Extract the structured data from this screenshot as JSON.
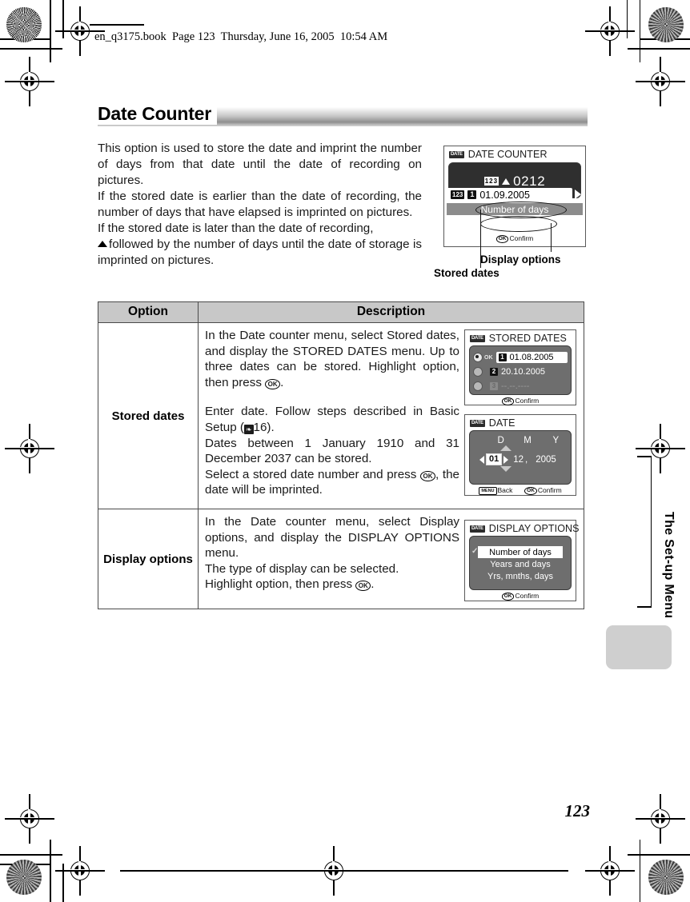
{
  "header": {
    "file_line": "en_q3175.book  Page 123  Thursday, June 16, 2005  10:54 AM"
  },
  "page": {
    "title": "Date Counter",
    "number": "123",
    "side_tab": "The Set-up Menu"
  },
  "intro": {
    "p1": "This option is used to store the date and imprint the number of days from that date until the date of recording on pictures.",
    "p2": "If the stored date is earlier than the date of recording, the number of days that have elapsed is imprinted on pictures.",
    "p3_pre": "",
    "p3": "followed by the number of days until the date of storage is imprinted on pictures.",
    "p3_lead": "If the stored date is later than the date of recording,"
  },
  "callouts": {
    "stored_dates": "Stored dates",
    "display_options": "Display options"
  },
  "lcd_date_counter": {
    "badge": "DATE",
    "title": "DATE COUNTER",
    "counter_segment": "123",
    "counter_value": "0212",
    "row_badge": "123",
    "row_number": "1",
    "row_date": "01.09.2005",
    "row_option": "Number of days",
    "footer_button": "OK",
    "footer_label": "Confirm"
  },
  "lcd_stored_dates": {
    "badge": "DATE",
    "title": "STORED DATES",
    "ok_marker": "OK",
    "rows": [
      {
        "num": "1",
        "date": "01.08.2005",
        "selected": true
      },
      {
        "num": "2",
        "date": "20.10.2005",
        "selected": false
      },
      {
        "num": "3",
        "date": "--.--.----",
        "selected": false
      }
    ],
    "footer_button": "OK",
    "footer_label": "Confirm"
  },
  "lcd_date": {
    "badge": "DATE",
    "title": "DATE",
    "head_d": "D",
    "head_m": "M",
    "head_y": "Y",
    "day": "01",
    "month": "12",
    "comma": ",",
    "year": "2005",
    "footer_back_button": "MENU",
    "footer_back_label": "Back",
    "footer_ok_button": "OK",
    "footer_ok_label": "Confirm"
  },
  "lcd_display_options": {
    "badge": "DATE",
    "title": "DISPLAY OPTIONS",
    "check": "✓",
    "items": [
      {
        "label": "Number of days",
        "selected": true
      },
      {
        "label": "Years and days",
        "selected": false
      },
      {
        "label": "Yrs, mnths, days",
        "selected": false
      }
    ],
    "footer_button": "OK",
    "footer_label": "Confirm"
  },
  "table": {
    "headers": {
      "option": "Option",
      "description": "Description"
    },
    "rows": [
      {
        "option": "Stored dates",
        "desc_1": "In the Date counter menu, select Stored dates, and display the STORED DATES menu. Up to three dates can be stored. Highlight option, then press",
        "desc_1_ok": "OK",
        "desc_1_tail": ".",
        "desc_2a": "Enter date. Follow steps described in Basic Setup (",
        "desc_2_book": "❧",
        "desc_2b": "16).",
        "desc_3": "Dates between 1 January 1910 and 31 December 2037 can be stored.",
        "desc_4a": "Select a stored date number and press",
        "desc_4_ok": "OK",
        "desc_4b": ", the date will be imprinted."
      },
      {
        "option": "Display options",
        "desc_1": "In the Date counter menu, select Display options, and display the DISPLAY OPTIONS menu.",
        "desc_2": "The type of display can be selected.",
        "desc_3a": "Highlight option, then press",
        "desc_3_ok": "OK",
        "desc_3b": "."
      }
    ]
  }
}
